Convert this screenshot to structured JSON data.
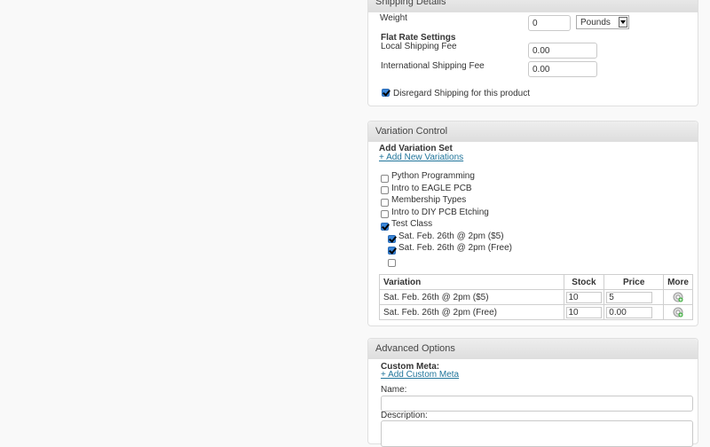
{
  "shipping": {
    "title": "Shipping Details",
    "weight_label": "Weight",
    "weight_value": "0",
    "weight_unit": "Pounds",
    "flat_rate_label": "Flat Rate Settings",
    "local_fee_label": "Local Shipping Fee",
    "local_fee_value": "0.00",
    "intl_fee_label": "International Shipping Fee",
    "intl_fee_value": "0.00",
    "disregard_label": "Disregard Shipping for this product",
    "disregard_checked": true
  },
  "variation": {
    "title": "Variation Control",
    "add_set_label": "Add Variation Set",
    "add_new_link": "+ Add New Variations",
    "sets": [
      {
        "label": "Python Programming",
        "checked": false
      },
      {
        "label": "Intro to EAGLE PCB",
        "checked": false
      },
      {
        "label": "Membership Types",
        "checked": false
      },
      {
        "label": "Intro to DIY PCB Etching",
        "checked": false
      },
      {
        "label": "Test Class",
        "checked": true
      }
    ],
    "sub_options": [
      {
        "label": "Sat. Feb. 26th @ 2pm ($5)",
        "checked": true
      },
      {
        "label": "Sat. Feb. 26th @ 2pm (Free)",
        "checked": true
      },
      {
        "label": "",
        "checked": false
      }
    ],
    "table": {
      "headers": [
        "Variation",
        "Stock",
        "Price",
        "More"
      ],
      "rows": [
        {
          "variation": "Sat. Feb. 26th @ 2pm ($5)",
          "stock": "10",
          "price": "5"
        },
        {
          "variation": "Sat. Feb. 26th @ 2pm (Free)",
          "stock": "10",
          "price": "0.00"
        }
      ]
    }
  },
  "advanced": {
    "title": "Advanced Options",
    "custom_meta_label": "Custom Meta:",
    "add_custom_meta_link": "+ Add Custom Meta",
    "name_label": "Name:",
    "name_value": "",
    "description_label": "Description:",
    "description_value": ""
  },
  "colors": {
    "link": "#21759b",
    "checkbox_checked": "#3b86d8",
    "header_bg": "#dedede"
  }
}
